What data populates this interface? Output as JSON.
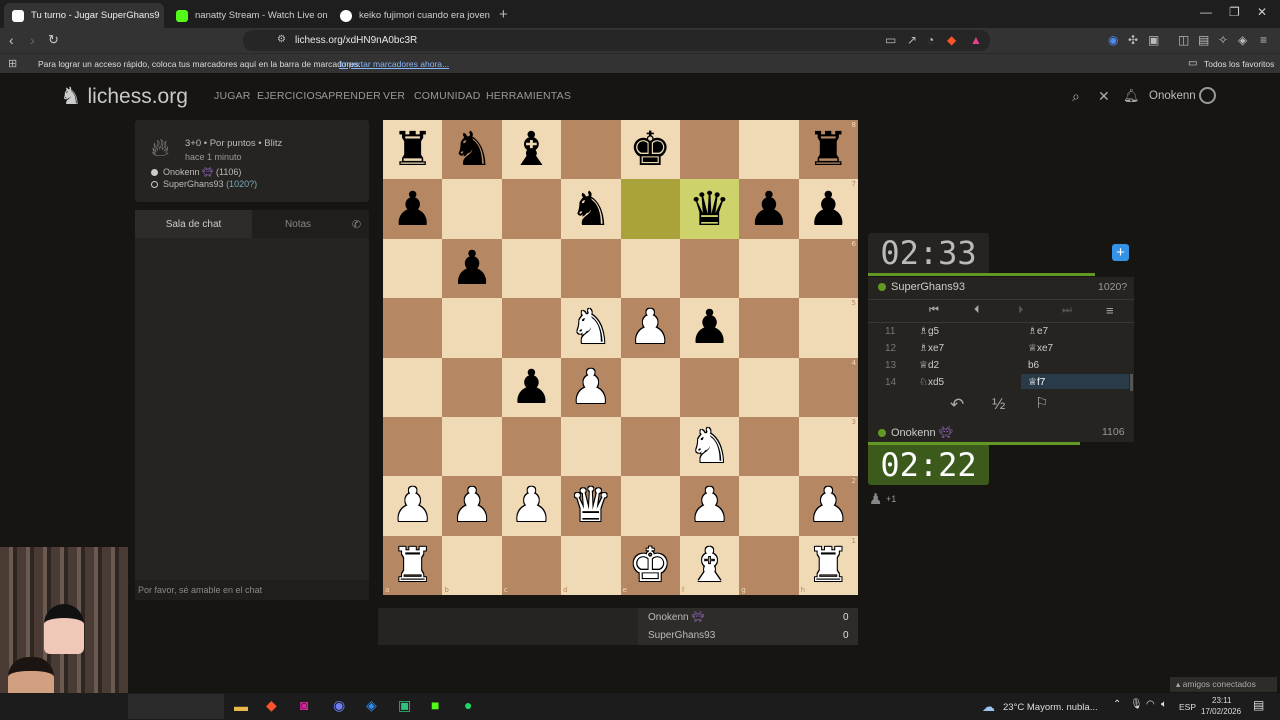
{
  "browser": {
    "tabs": [
      {
        "title": "Tu turno - Jugar SuperGhans9",
        "active": true
      },
      {
        "title": "nanatty Stream - Watch Live on K",
        "active": false
      },
      {
        "title": "keiko fujimori cuando era joven - Bu",
        "active": false
      }
    ],
    "url": "lichess.org/xdHN9nA0bc3R",
    "bookmarks_hint": "Para lograr un acceso rápido, coloca tus marcadores aquí en la barra de marcadores.",
    "bookmarks_link": "Importar marcadores ahora...",
    "all_bookmarks": "Todos los favoritos"
  },
  "site": {
    "logo": "lichess.org",
    "nav": [
      "JUGAR",
      "EJERCICIOS",
      "APRENDER",
      "VER",
      "COMUNIDAD",
      "HERRAMIENTAS"
    ],
    "user": "Onokenn"
  },
  "game": {
    "type": "3+0 • Por puntos • Blitz",
    "time": "hace 1 minuto",
    "white_player": "Onokenn",
    "white_rating": "(1106)",
    "black_player": "SuperGhans93",
    "black_rating": "(1020?)"
  },
  "chat": {
    "tab_chat": "Sala de chat",
    "tab_notes": "Notas",
    "placeholder": "Por favor, sé amable en el chat"
  },
  "board": {
    "files": [
      "a",
      "b",
      "c",
      "d",
      "e",
      "f",
      "g",
      "h"
    ],
    "ranks": [
      "8",
      "7",
      "6",
      "5",
      "4",
      "3",
      "2",
      "1"
    ],
    "pieces": [
      [
        "r",
        "n",
        "b",
        "",
        "k",
        "",
        "",
        "r"
      ],
      [
        "p",
        "",
        "",
        "n",
        "",
        "q",
        "p",
        "p"
      ],
      [
        "",
        "p",
        "",
        "",
        "",
        "",
        "",
        ""
      ],
      [
        "",
        "",
        "",
        "N",
        "P",
        "p",
        "",
        ""
      ],
      [
        "",
        "",
        "p",
        "P",
        "",
        "",
        "",
        ""
      ],
      [
        "",
        "",
        "",
        "",
        "",
        "N",
        "",
        ""
      ],
      [
        "P",
        "P",
        "P",
        "Q",
        "",
        "P",
        "",
        "P"
      ],
      [
        "R",
        "",
        "",
        "",
        "K",
        "B",
        "",
        "R"
      ]
    ],
    "highlight": [
      "e7",
      "f7"
    ]
  },
  "clocks": {
    "top": "02:33",
    "bottom": "02:22"
  },
  "opponent": {
    "name": "SuperGhans93",
    "rating": "1020?"
  },
  "player": {
    "name": "Onokenn",
    "rating": "1106"
  },
  "moves": [
    {
      "n": "11",
      "w": "♗g5",
      "b": "♗e7"
    },
    {
      "n": "12",
      "w": "♗xe7",
      "b": "♕xe7"
    },
    {
      "n": "13",
      "w": "♕d2",
      "b": "b6"
    },
    {
      "n": "14",
      "w": "♘xd5",
      "b": "♕f7"
    }
  ],
  "actions": {
    "draw": "½"
  },
  "captured": "+1",
  "score": {
    "p1": "Onokenn",
    "p1_score": "0",
    "p2": "SuperGhans93",
    "p2_score": "0"
  },
  "taskbar": {
    "weather": "23°C  Mayorm. nubla...",
    "lang": "ESP",
    "time": "23:11",
    "date": "17/02/2026",
    "friends": "amigos conectados"
  }
}
